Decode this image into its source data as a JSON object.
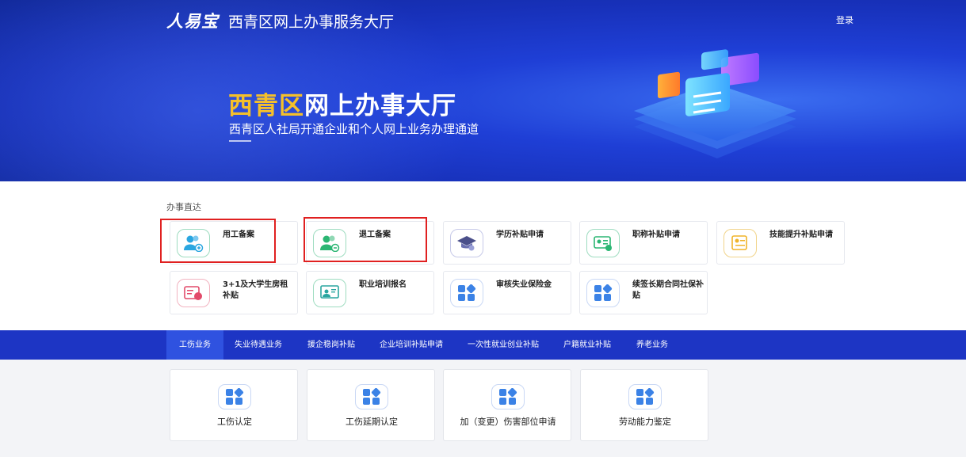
{
  "header": {
    "logo_text": "人易宝",
    "title": "西青区网上办事服务大厅",
    "login": "登录"
  },
  "hero": {
    "title_highlight": "西青区",
    "title_rest": "网上办事大厅",
    "subtitle": "西青区人社局开通企业和个人网上业务办理通道"
  },
  "section": {
    "label": "办事直达"
  },
  "quick_items": [
    {
      "label": "用工备案",
      "icon": "user-add-icon"
    },
    {
      "label": "退工备案",
      "icon": "user-remove-icon"
    },
    {
      "label": "学历补贴申请",
      "icon": "graduation-cap-icon"
    },
    {
      "label": "职称补贴申请",
      "icon": "id-card-subsidy-icon"
    },
    {
      "label": "技能提升补贴申请",
      "icon": "certificate-icon"
    },
    {
      "label": "3+1及大学生房租补贴",
      "icon": "rent-subsidy-icon"
    },
    {
      "label": "职业培训报名",
      "icon": "training-screen-icon"
    },
    {
      "label": "审核失业保险金",
      "icon": "apps-grid-icon"
    },
    {
      "label": "续签长期合同社保补贴",
      "icon": "apps-grid-icon"
    }
  ],
  "tabs": [
    {
      "label": "工伤业务",
      "active": true
    },
    {
      "label": "失业待遇业务"
    },
    {
      "label": "援企稳岗补贴"
    },
    {
      "label": "企业培训补贴申请"
    },
    {
      "label": "一次性就业创业补贴"
    },
    {
      "label": "户籍就业补贴"
    },
    {
      "label": "养老业务"
    }
  ],
  "service_cards": [
    {
      "label": "工伤认定",
      "icon": "apps-grid-icon"
    },
    {
      "label": "工伤延期认定",
      "icon": "apps-grid-icon"
    },
    {
      "label": "加（变更）伤害部位申请",
      "icon": "apps-grid-icon"
    },
    {
      "label": "劳动能力鉴定",
      "icon": "apps-grid-icon"
    }
  ],
  "colors": {
    "primary": "#1d35c4",
    "highlight": "#f5c02a",
    "green": "#2bb673",
    "blue_icon": "#3b82e6",
    "red_highlight_box": "#e02020"
  }
}
